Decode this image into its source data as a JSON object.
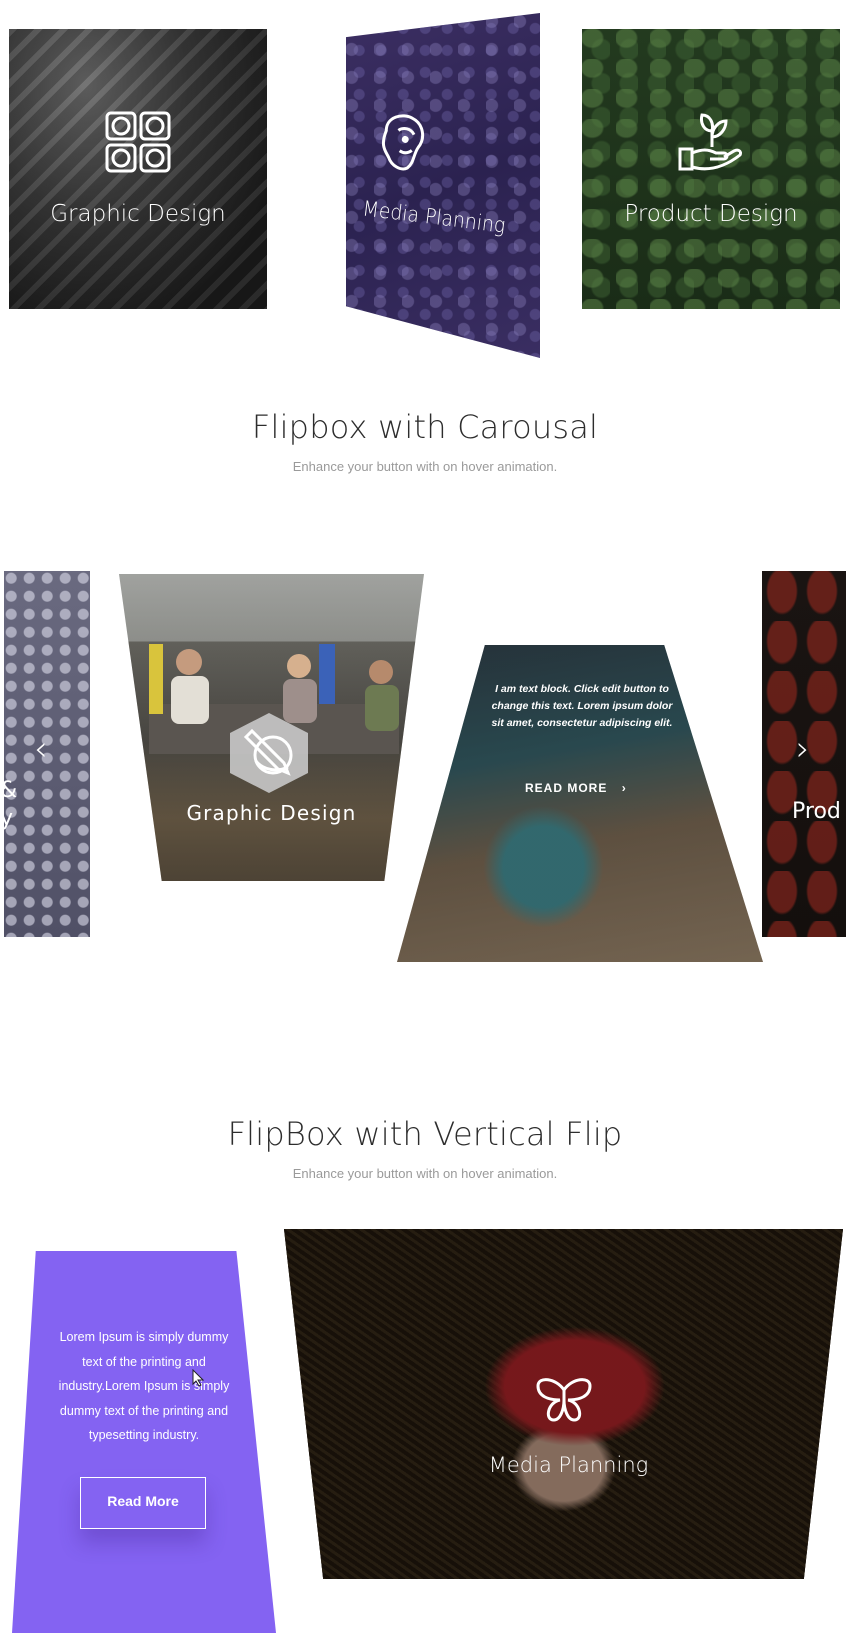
{
  "row1": {
    "cards": [
      {
        "label": "Graphic Design",
        "icon": "grid-circles-icon"
      },
      {
        "label": "Media Planning",
        "icon": "lion-head-icon"
      },
      {
        "label": "Product Design",
        "icon": "hand-plant-icon"
      }
    ]
  },
  "section_carousel": {
    "title": "Flipbox with Carousal",
    "subtitle": "Enhance your button with on hover animation."
  },
  "carousel": {
    "left_partial_text": "&\ny",
    "center_card": {
      "label": "Graphic Design",
      "icon": "hexagon-pen-icon"
    },
    "flipped_card": {
      "text": "I am text block. Click edit button to change this text. Lorem ipsum dolor sit amet, consectetur adipiscing elit.",
      "button": "READ MORE"
    },
    "right_partial_text": "Prod",
    "prev_arrow": "‹",
    "next_arrow": "›"
  },
  "section_vertical": {
    "title": "FlipBox with Vertical Flip",
    "subtitle": "Enhance your button with on hover animation."
  },
  "vertical": {
    "purple_card": {
      "text": "Lorem Ipsum is simply dummy text of the printing and industry.Lorem Ipsum is simply dummy text of the printing and typesetting industry.",
      "button": "Read More"
    },
    "image_card": {
      "label": "Media Planning",
      "icon": "butterfly-icon"
    }
  },
  "colors": {
    "accent_purple": "#8463f2",
    "title_text": "#2d2d2d",
    "subtitle_text": "#9a9a9a"
  }
}
